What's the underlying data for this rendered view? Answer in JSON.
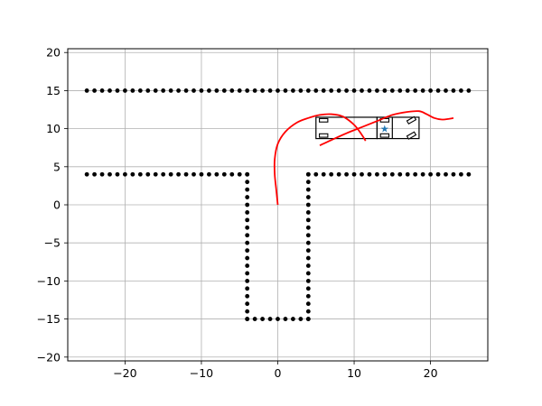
{
  "chart_data": {
    "type": "scatter",
    "title": "",
    "xlabel": "",
    "ylabel": "",
    "xlim": [
      -27.5,
      27.5
    ],
    "ylim": [
      -20.5,
      20.5
    ],
    "grid": true,
    "xticks": [
      -20,
      -10,
      0,
      10,
      20
    ],
    "xtick_labels": [
      "−20",
      "−10",
      "0",
      "10",
      "20"
    ],
    "yticks": [
      -20,
      -15,
      -10,
      -5,
      0,
      5,
      10,
      15,
      20
    ],
    "ytick_labels": [
      "−20",
      "−15",
      "−10",
      "−5",
      "0",
      "5",
      "10",
      "15",
      "20"
    ],
    "obstacles": {
      "color": "#000000",
      "segments": [
        {
          "from": [
            -25,
            15
          ],
          "to": [
            25,
            15
          ],
          "step": 1
        },
        {
          "from": [
            -25,
            4
          ],
          "to": [
            -4,
            4
          ],
          "step": 1
        },
        {
          "from": [
            4,
            4
          ],
          "to": [
            25,
            4
          ],
          "step": 1
        },
        {
          "from": [
            -4,
            4
          ],
          "to": [
            -4,
            -15
          ],
          "step": 1
        },
        {
          "from": [
            4,
            4
          ],
          "to": [
            4,
            -15
          ],
          "step": 1
        },
        {
          "from": [
            -4,
            -15
          ],
          "to": [
            4,
            -15
          ],
          "step": 1
        }
      ]
    },
    "paths": [
      {
        "color": "#ff0000",
        "points": [
          [
            0,
            0
          ],
          [
            -0.2,
            2
          ],
          [
            -0.4,
            4
          ],
          [
            -0.4,
            6
          ],
          [
            0,
            8
          ],
          [
            1,
            9.6
          ],
          [
            2.5,
            10.8
          ],
          [
            4,
            11.4
          ],
          [
            5.5,
            11.8
          ],
          [
            7,
            11.9
          ],
          [
            8.5,
            11.6
          ],
          [
            10,
            10.5
          ],
          [
            11,
            9.2
          ],
          [
            11.5,
            8.4
          ]
        ]
      },
      {
        "color": "#ff0000",
        "points": [
          [
            5.5,
            7.8
          ],
          [
            7,
            8.5
          ],
          [
            9,
            9.4
          ],
          [
            11,
            10.2
          ],
          [
            13,
            11
          ],
          [
            15,
            11.8
          ],
          [
            17,
            12.2
          ],
          [
            18.5,
            12.3
          ],
          [
            19.5,
            11.9
          ],
          [
            20.5,
            11.4
          ],
          [
            21.5,
            11.2
          ],
          [
            22.5,
            11.3
          ],
          [
            23,
            11.4
          ]
        ]
      }
    ],
    "vehicle": {
      "color": "#000000",
      "body": {
        "x": [
          5,
          13
        ],
        "y": [
          8.7,
          11.5
        ]
      },
      "cab": {
        "x": [
          13,
          18.5
        ],
        "y": [
          8.7,
          11.5
        ]
      },
      "cab_divider_x": 15,
      "wheels": [
        {
          "center": [
            6,
            11.1
          ],
          "angle": 0
        },
        {
          "center": [
            6,
            9.1
          ],
          "angle": 0
        },
        {
          "center": [
            14,
            11.1
          ],
          "angle": 0
        },
        {
          "center": [
            14,
            9.1
          ],
          "angle": 0
        },
        {
          "center": [
            17.5,
            11.1
          ],
          "angle": 30
        },
        {
          "center": [
            17.5,
            9.1
          ],
          "angle": 30
        }
      ],
      "wheel_length": 1.1,
      "wheel_width": 0.45
    },
    "marker": {
      "x": 14,
      "y": 10,
      "color": "#1f77b4",
      "symbol": "★"
    }
  }
}
